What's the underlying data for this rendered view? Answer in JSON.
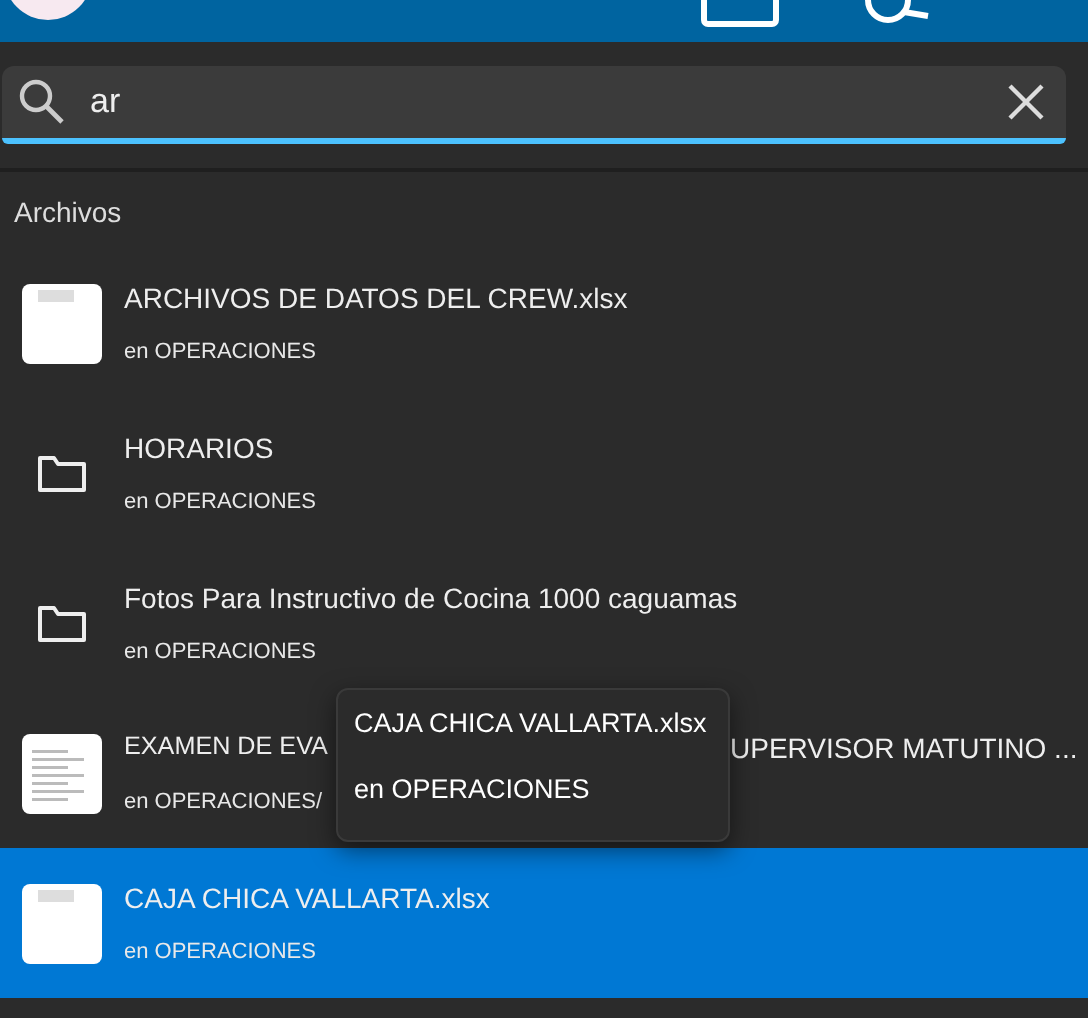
{
  "search": {
    "value": "ar"
  },
  "section_title": "Archivos",
  "results": [
    {
      "kind": "file",
      "title": "ARCHIVOS DE DATOS DEL CREW.xlsx",
      "location": "en OPERACIONES",
      "selected": false
    },
    {
      "kind": "folder",
      "title": "HORARIOS",
      "location": "en OPERACIONES",
      "selected": false
    },
    {
      "kind": "folder",
      "title": "Fotos Para Instructivo de Cocina 1000 caguamas",
      "location": "en OPERACIONES",
      "selected": false
    },
    {
      "kind": "document",
      "title": "EXAMEN DE EVA",
      "title_end": "UPERVISOR MATUTINO ...",
      "location": "en OPERACIONES/",
      "selected": false,
      "tooltip": {
        "title": "CAJA CHICA VALLARTA.xlsx",
        "location": "en OPERACIONES"
      }
    },
    {
      "kind": "file",
      "title": "CAJA CHICA VALLARTA.xlsx",
      "location": "en OPERACIONES",
      "selected": true
    }
  ]
}
